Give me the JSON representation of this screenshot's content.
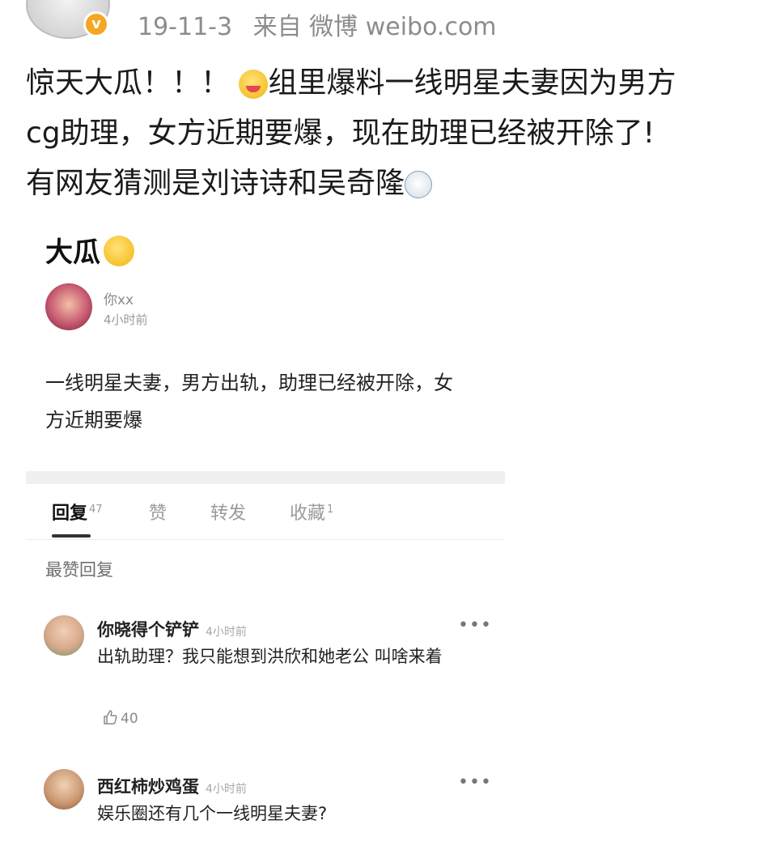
{
  "header": {
    "date": "19-11-3",
    "source": "来自 微博 weibo.com"
  },
  "post": {
    "line1": "惊天大瓜！！！",
    "line1b": "组里爆料一线明星夫妻因为男方",
    "line2": "cg助理，女方近期要爆，现在助理已经被开除了!",
    "line3": "有网友猜测是刘诗诗和吴奇隆"
  },
  "card": {
    "title": "大瓜",
    "op": {
      "name": "你xx",
      "time": "4小时前",
      "body": "一线明星夫妻，男方出轨，助理已经被开除，女方近期要爆"
    },
    "tabs": [
      {
        "label": "回复",
        "count": "47"
      },
      {
        "label": "赞",
        "count": ""
      },
      {
        "label": "转发",
        "count": ""
      },
      {
        "label": "收藏",
        "count": "1"
      }
    ],
    "section_label": "最赞回复",
    "comments": [
      {
        "name": "你晓得个铲铲",
        "time": "4小时前",
        "more": "•••",
        "text": "出轨助理？我只能想到洪欣和她老公 叫啥来着",
        "likes": "40"
      },
      {
        "name": "西红柿炒鸡蛋",
        "time": "4小时前",
        "more": "•••",
        "text": "娱乐圈还有几个一线明星夫妻?"
      }
    ]
  },
  "colors": {
    "verified_badge": "#f5a623",
    "meta_text": "#8c8c8c",
    "divider": "#f0f0f0"
  },
  "icons": [
    "verified-badge-icon",
    "yum-emoji-icon",
    "dizzy-emoji-icon",
    "hug-emoji-icon",
    "more-dots-icon",
    "thumbs-up-icon"
  ]
}
